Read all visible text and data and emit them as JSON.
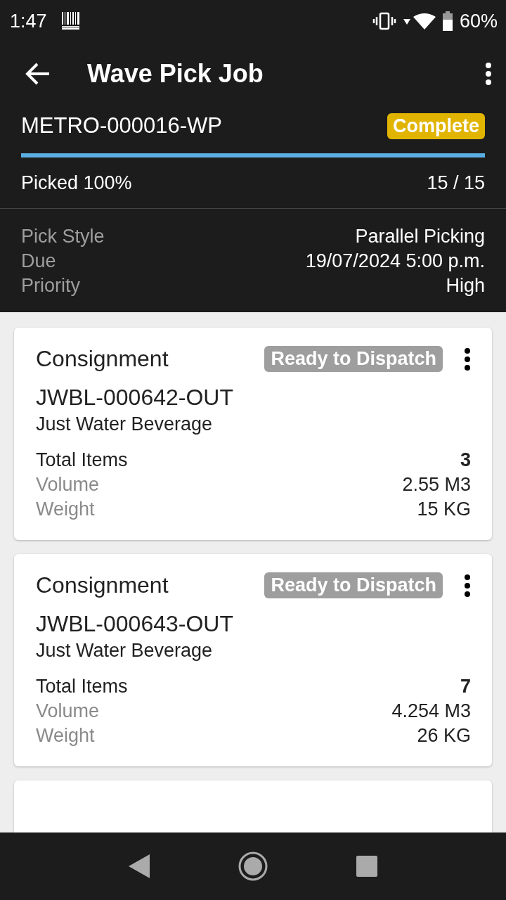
{
  "status_bar": {
    "time": "1:47",
    "battery": "60%"
  },
  "app_bar": {
    "title": "Wave Pick Job"
  },
  "job": {
    "id": "METRO-000016-WP",
    "status": "Complete",
    "progress_label": "Picked 100%",
    "level": 1,
    "count": "15 / 15"
  },
  "details": [
    {
      "label": "Pick Style",
      "value": "Parallel Picking"
    },
    {
      "label": "Due",
      "value": "19/07/2024 5:00 p.m."
    },
    {
      "label": "Priority",
      "value": "High"
    }
  ],
  "consignments": [
    {
      "title": "Consignment",
      "status": "Ready to Dispatch",
      "number": "JWBL-000642-OUT",
      "customer": "Just Water Beverage",
      "rows": [
        {
          "label": "Total Items",
          "value": "3",
          "bold": true
        },
        {
          "label": "Volume",
          "value": "2.55 M3",
          "bold": false
        },
        {
          "label": "Weight",
          "value": "15 KG",
          "bold": false
        }
      ]
    },
    {
      "title": "Consignment",
      "status": "Ready to Dispatch",
      "number": "JWBL-000643-OUT",
      "customer": "Just Water Beverage",
      "rows": [
        {
          "label": "Total Items",
          "value": "7",
          "bold": true
        },
        {
          "label": "Volume",
          "value": "4.254 M3",
          "bold": false
        },
        {
          "label": "Weight",
          "value": "26 KG",
          "bold": false
        }
      ]
    }
  ]
}
